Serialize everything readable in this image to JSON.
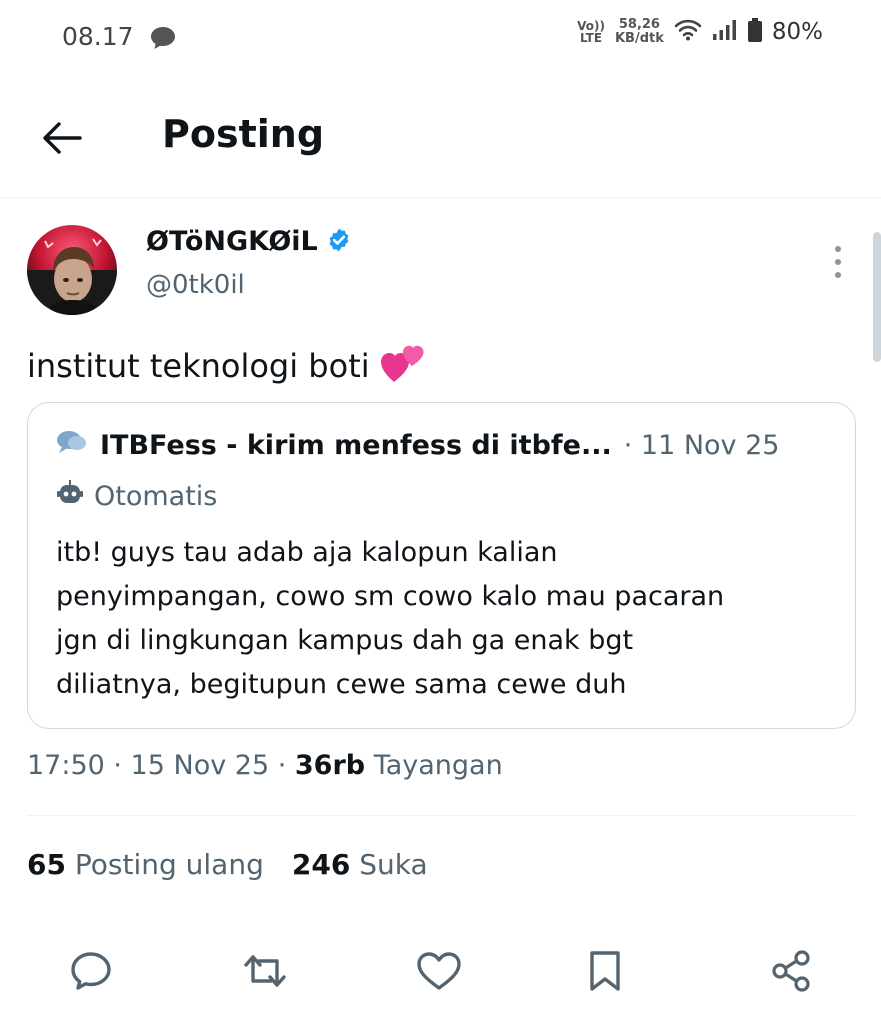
{
  "status_bar": {
    "time": "08.17",
    "volte_top": "Vo))",
    "volte_bottom": "LTE",
    "speed_value": "58,26",
    "speed_unit": "KB/dtk",
    "battery": "80%"
  },
  "header": {
    "title": "Posting",
    "back_icon": "arrow-left-icon"
  },
  "post": {
    "author_name": "ØTöNGKØiL",
    "author_handle": "@0tk0il",
    "verified_icon": "verified-badge-icon",
    "text": "institut teknologi boti",
    "emoji": "💕",
    "timestamp": "17:50 · 15 Nov 25 · ",
    "views_count": "36rb",
    "views_label": "Tayangan"
  },
  "quote": {
    "name": "ITBFess - kirim menfess di itbfe...",
    "date": "· 11 Nov 25",
    "automated_label": "Otomatis",
    "lines": [
      "itb! guys tau adab aja kalopun kalian",
      "penyimpangan, cowo sm cowo kalo mau pacaran",
      "jgn di lingkungan kampus dah ga enak bgt",
      "diliatnya, begitupun cewe sama cewe duh"
    ]
  },
  "stats": {
    "reposts_count": "65",
    "reposts_label": "Posting ulang",
    "likes_count": "246",
    "likes_label": "Suka"
  },
  "actions": [
    "reply-icon",
    "repost-icon",
    "like-icon",
    "bookmark-icon",
    "share-icon"
  ],
  "colors": {
    "text_primary": "#0f1419",
    "text_secondary": "#536471",
    "verified_blue": "#1d9bf0",
    "border": "#cfd9de",
    "icon": "#536471"
  }
}
